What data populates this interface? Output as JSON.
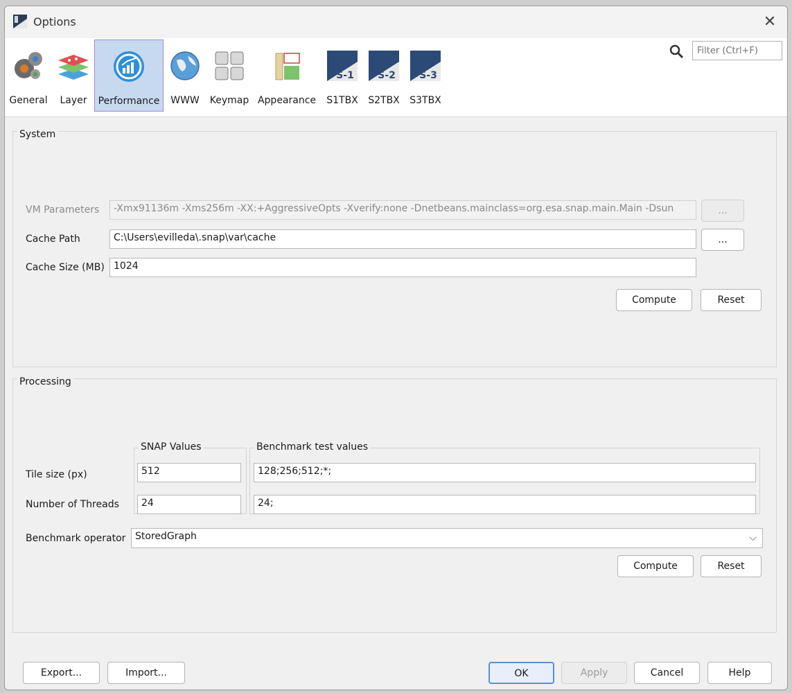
{
  "window": {
    "title": "Options",
    "close_glyph": "✕"
  },
  "toolbar": {
    "items": [
      {
        "label": "General",
        "icon": "gears-icon"
      },
      {
        "label": "Layer",
        "icon": "layers-icon"
      },
      {
        "label": "Performance",
        "icon": "performance-gauge-icon",
        "selected": true
      },
      {
        "label": "WWW",
        "icon": "globe-icon"
      },
      {
        "label": "Keymap",
        "icon": "keyboard-icon"
      },
      {
        "label": "Appearance",
        "icon": "appearance-icon"
      },
      {
        "label": "S1TBX",
        "icon": "snap-s1-icon",
        "badge": "S-1"
      },
      {
        "label": "S2TBX",
        "icon": "snap-s2-icon",
        "badge": "S-2"
      },
      {
        "label": "S3TBX",
        "icon": "snap-s3-icon",
        "badge": "S-3"
      }
    ],
    "filter_placeholder": "Filter (Ctrl+F)"
  },
  "system": {
    "title": "System",
    "vm_label": "VM Parameters",
    "vm_value": "-Xmx91136m  -Xms256m -XX:+AggressiveOpts -Xverify:none -Dnetbeans.mainclass=org.esa.snap.main.Main -Dsun",
    "cache_path_label": "Cache Path",
    "cache_path_value": "C:\\Users\\evilleda\\.snap\\var\\cache",
    "cache_size_label": "Cache Size (MB)",
    "cache_size_value": "1024",
    "browse_label": "...",
    "compute_label": "Compute",
    "reset_label": "Reset"
  },
  "processing": {
    "title": "Processing",
    "snap_values_title": "SNAP Values",
    "benchmark_title": "Benchmark test values",
    "tile_size_label": "Tile size (px)",
    "tile_size_value": "512",
    "tile_size_bench": "128;256;512;*;",
    "threads_label": "Number of Threads",
    "threads_value": "24",
    "threads_bench": "24;",
    "operator_label": "Benchmark operator",
    "operator_value": "StoredGraph",
    "compute_label": "Compute",
    "reset_label": "Reset"
  },
  "footer": {
    "export_label": "Export...",
    "import_label": "Import...",
    "ok_label": "OK",
    "apply_label": "Apply",
    "cancel_label": "Cancel",
    "help_label": "Help"
  },
  "colors": {
    "selected_bg": "#c7d9ef",
    "selected_border": "#a486d9",
    "default_button": "#5b8fd6"
  }
}
